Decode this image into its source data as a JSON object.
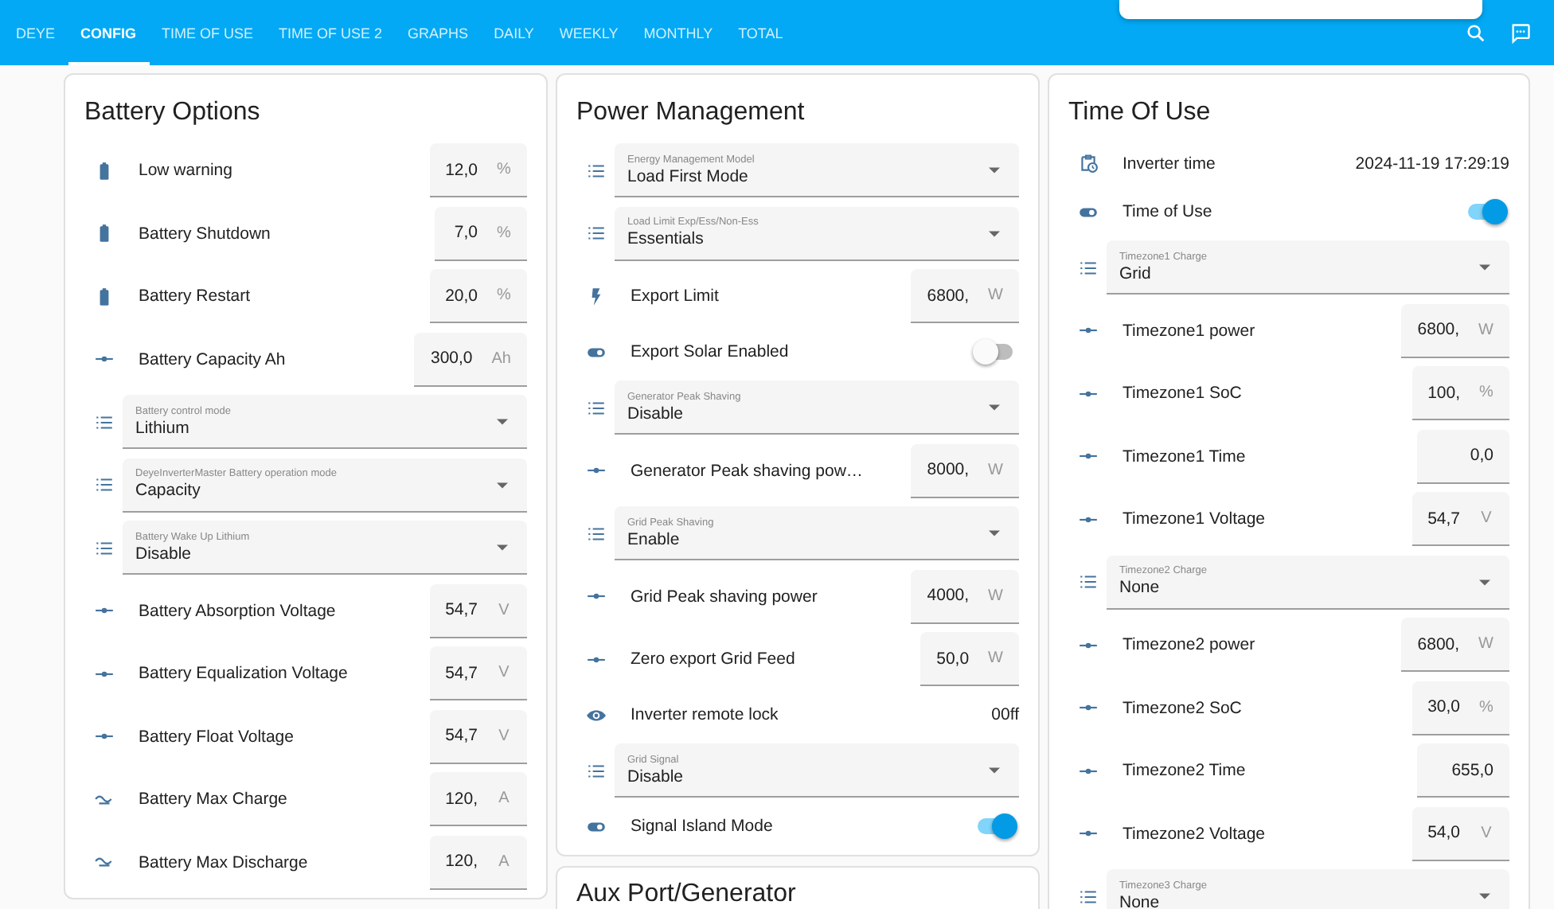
{
  "nav": {
    "tabs": [
      {
        "label": "DEYE",
        "selected": false
      },
      {
        "label": "CONFIG",
        "selected": true
      },
      {
        "label": "TIME OF USE",
        "selected": false
      },
      {
        "label": "TIME OF USE 2",
        "selected": false
      },
      {
        "label": "GRAPHS",
        "selected": false
      },
      {
        "label": "DAILY",
        "selected": false
      },
      {
        "label": "WEEKLY",
        "selected": false
      },
      {
        "label": "MONTHLY",
        "selected": false
      },
      {
        "label": "TOTAL",
        "selected": false
      }
    ]
  },
  "columns": [
    {
      "cards": [
        {
          "title": "Battery Options",
          "rows": [
            {
              "kind": "battery",
              "label": "Low warning",
              "value": "12,0",
              "unit": "%"
            },
            {
              "kind": "battery",
              "label": "Battery Shutdown",
              "value": "7,0",
              "unit": "%"
            },
            {
              "kind": "battery",
              "label": "Battery Restart",
              "value": "20,0",
              "unit": "%"
            },
            {
              "kind": "number",
              "label": "Battery Capacity Ah",
              "value": "300,0",
              "unit": "Ah"
            },
            {
              "kind": "select",
              "label": "Battery control mode",
              "value": "Lithium"
            },
            {
              "kind": "select",
              "label": "DeyeInverterMaster Battery operation mode",
              "value": "Capacity"
            },
            {
              "kind": "select",
              "label": "Battery Wake Up Lithium",
              "value": "Disable"
            },
            {
              "kind": "number",
              "label": "Battery Absorption Voltage",
              "value": "54,7",
              "unit": "V"
            },
            {
              "kind": "number",
              "label": "Battery Equalization Voltage",
              "value": "54,7",
              "unit": "V"
            },
            {
              "kind": "number",
              "label": "Battery Float Voltage",
              "value": "54,7",
              "unit": "V"
            },
            {
              "kind": "current",
              "label": "Battery Max Charge",
              "value": "120,",
              "unit": "A"
            },
            {
              "kind": "current",
              "label": "Battery Max Discharge",
              "value": "120,",
              "unit": "A"
            }
          ]
        }
      ]
    },
    {
      "cards": [
        {
          "title": "Power Management",
          "rows": [
            {
              "kind": "select",
              "label": "Energy Management Model",
              "value": "Load First Mode"
            },
            {
              "kind": "select",
              "label": "Load Limit Exp/Ess/Non-Ess",
              "value": "Essentials"
            },
            {
              "kind": "power",
              "label": "Export Limit",
              "value": "6800,",
              "unit": "W"
            },
            {
              "kind": "switch",
              "label": "Export Solar Enabled",
              "on": false
            },
            {
              "kind": "select",
              "label": "Generator Peak Shaving",
              "value": "Disable"
            },
            {
              "kind": "number",
              "label": "Generator Peak shaving pow…",
              "value": "8000,",
              "unit": "W"
            },
            {
              "kind": "select",
              "label": "Grid Peak Shaving",
              "value": "Enable"
            },
            {
              "kind": "number",
              "label": "Grid Peak shaving power",
              "value": "4000,",
              "unit": "W"
            },
            {
              "kind": "number",
              "label": "Zero export Grid Feed",
              "value": "50,0",
              "unit": "W"
            },
            {
              "kind": "lock",
              "label": "Inverter remote lock",
              "value": "00ff"
            },
            {
              "kind": "select",
              "label": "Grid Signal",
              "value": "Disable"
            },
            {
              "kind": "switch",
              "label": "Signal Island Mode",
              "on": true
            }
          ]
        },
        {
          "title": "Aux Port/Generator"
        }
      ]
    },
    {
      "cards": [
        {
          "title": "Time Of Use",
          "rows": [
            {
              "kind": "clock",
              "label": "Inverter time",
              "value": "2024-11-19 17:29:19"
            },
            {
              "kind": "switch",
              "label": "Time of Use",
              "on": true
            },
            {
              "kind": "select",
              "label": "Timezone1 Charge",
              "value": "Grid"
            },
            {
              "kind": "number",
              "label": "Timezone1 power",
              "value": "6800,",
              "unit": "W"
            },
            {
              "kind": "number",
              "label": "Timezone1 SoC",
              "value": "100,",
              "unit": "%"
            },
            {
              "kind": "number",
              "label": "Timezone1 Time",
              "value": "0,0"
            },
            {
              "kind": "number",
              "label": "Timezone1 Voltage",
              "value": "54,7",
              "unit": "V"
            },
            {
              "kind": "select",
              "label": "Timezone2 Charge",
              "value": "None"
            },
            {
              "kind": "number",
              "label": "Timezone2 power",
              "value": "6800,",
              "unit": "W"
            },
            {
              "kind": "number",
              "label": "Timezone2 SoC",
              "value": "30,0",
              "unit": "%"
            },
            {
              "kind": "number",
              "label": "Timezone2 Time",
              "value": "655,0"
            },
            {
              "kind": "number",
              "label": "Timezone2 Voltage",
              "value": "54,0",
              "unit": "V"
            },
            {
              "kind": "select",
              "label": "Timezone3 Charge",
              "value": "None"
            }
          ]
        }
      ]
    }
  ]
}
